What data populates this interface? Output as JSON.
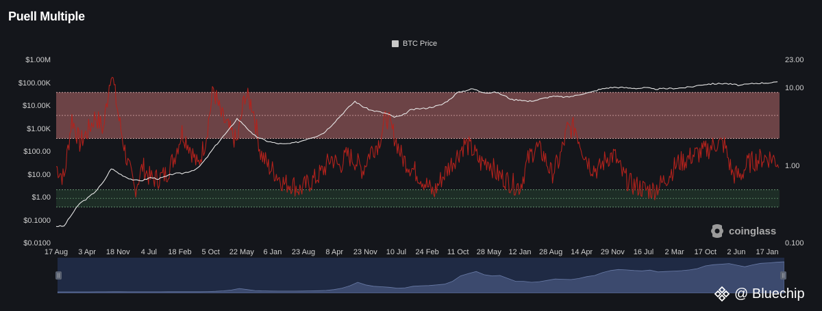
{
  "title": "Puell Multiple",
  "legend": {
    "label": "BTC Price",
    "color": "#c9c9c9"
  },
  "watermark": "coinglass",
  "brand": "@ Bluechip",
  "colors": {
    "background": "#14161b",
    "btc_price_line": "#e8e8e8",
    "puell_line": "#b3221c",
    "top_band": "#b56a6a",
    "bottom_band": "#2f5a3c",
    "navigator_area": "#3c4a6e"
  },
  "chart_data": {
    "type": "line",
    "title": "Puell Multiple",
    "legend_position": "top-center",
    "grid": false,
    "left_axis": {
      "scale": "log",
      "range": [
        0.01,
        1000000
      ],
      "ticks": [
        "$1.00M",
        "$100.00K",
        "$10.00K",
        "$1.00K",
        "$100.00",
        "$10.00",
        "$1.00",
        "$0.1000",
        "$0.0100"
      ]
    },
    "right_axis": {
      "scale": "log",
      "range": [
        0.1,
        23
      ],
      "ticks": [
        "23.00",
        "10.00",
        "1.00",
        "0.100"
      ]
    },
    "x_ticks": [
      "17 Aug",
      "3 Apr",
      "18 Nov",
      "4 Jul",
      "18 Feb",
      "5 Oct",
      "22 May",
      "6 Jan",
      "23 Aug",
      "8 Apr",
      "23 Nov",
      "10 Jul",
      "24 Feb",
      "11 Oct",
      "28 May",
      "12 Jan",
      "28 Aug",
      "14 Apr",
      "29 Nov",
      "16 Jul",
      "2 Mar",
      "17 Oct",
      "2 Jun",
      "17 Jan"
    ],
    "bands": [
      {
        "name": "top",
        "axis": "right",
        "from": 2.3,
        "to": 9
      },
      {
        "name": "bottom",
        "axis": "right",
        "from": 0.3,
        "to": 0.5
      }
    ],
    "series": [
      {
        "name": "BTC Price",
        "axis": "left",
        "x": [
          0,
          1,
          2,
          3,
          4,
          5,
          6,
          7,
          8,
          9,
          10,
          11,
          12,
          13,
          14,
          15,
          16,
          17,
          18,
          19,
          20,
          21,
          22,
          23,
          24,
          25,
          26,
          27,
          28,
          29,
          30,
          31,
          32,
          33,
          34,
          35,
          36,
          37,
          38,
          39,
          40,
          41,
          42,
          43,
          44,
          45,
          46,
          47,
          48,
          49,
          50,
          51,
          52,
          53,
          54,
          55,
          56,
          57,
          58,
          59,
          60,
          61,
          62,
          63,
          64,
          65,
          66,
          67,
          68,
          69,
          70,
          71,
          72,
          73,
          74,
          75,
          76,
          77,
          78,
          79,
          80,
          81,
          82,
          83,
          84,
          85,
          86,
          87,
          88,
          89,
          90,
          91,
          92
        ],
        "values": [
          0.06,
          0.06,
          0.2,
          0.6,
          1,
          2,
          5,
          20,
          12,
          8,
          6,
          6,
          8,
          7,
          9,
          12,
          12,
          15,
          20,
          50,
          150,
          400,
          1000,
          3000,
          1500,
          600,
          400,
          300,
          250,
          230,
          250,
          300,
          400,
          500,
          700,
          1500,
          3500,
          8000,
          17000,
          10000,
          7000,
          6000,
          5000,
          3500,
          4000,
          7000,
          8000,
          8500,
          10000,
          12000,
          20000,
          40000,
          50000,
          60000,
          45000,
          40000,
          42000,
          30000,
          20000,
          20000,
          17000,
          19000,
          23000,
          28000,
          27000,
          26000,
          30000,
          37000,
          42000,
          55000,
          65000,
          70000,
          68000,
          65000,
          63000,
          67000,
          58000,
          60000,
          62000,
          64000,
          68000,
          75000,
          90000,
          97000,
          100000,
          104000,
          94000,
          85000,
          96000,
          105000,
          108000,
          112000,
          115000
        ],
        "color": "#e8e8e8"
      },
      {
        "name": "Puell Multiple",
        "axis": "right",
        "x": [
          0,
          1,
          2,
          3,
          4,
          5,
          6,
          7,
          8,
          9,
          10,
          11,
          12,
          13,
          14,
          15,
          16,
          17,
          18,
          19,
          20,
          21,
          22,
          23,
          24,
          25,
          26,
          27,
          28,
          29,
          30,
          31,
          32,
          33,
          34,
          35,
          36,
          37,
          38,
          39,
          40,
          41,
          42,
          43,
          44,
          45,
          46,
          47,
          48,
          49,
          50,
          51,
          52,
          53,
          54,
          55,
          56,
          57,
          58,
          59,
          60,
          61,
          62,
          63,
          64,
          65,
          66,
          67,
          68,
          69,
          70,
          71,
          72,
          73,
          74,
          75,
          76,
          77,
          78,
          79,
          80,
          81,
          82,
          83,
          84,
          85,
          86,
          87,
          88,
          89,
          90,
          91,
          92
        ],
        "values": [
          1.0,
          0.7,
          4.2,
          2.0,
          2.8,
          4.5,
          3.0,
          18.0,
          4.0,
          1.2,
          0.5,
          1.0,
          0.7,
          0.7,
          0.8,
          1.3,
          2.8,
          1.8,
          1.0,
          2.2,
          10.0,
          4.5,
          3.0,
          2.0,
          8.5,
          6.0,
          1.5,
          1.0,
          0.8,
          0.6,
          0.6,
          0.5,
          0.6,
          0.7,
          0.9,
          1.3,
          1.0,
          1.4,
          1.2,
          0.9,
          1.6,
          2.0,
          4.5,
          2.5,
          1.3,
          1.0,
          0.8,
          0.6,
          0.45,
          0.7,
          1.0,
          1.4,
          2.0,
          1.6,
          1.1,
          1.2,
          0.8,
          0.7,
          0.6,
          0.55,
          1.2,
          1.8,
          1.4,
          0.8,
          1.2,
          3.0,
          3.2,
          1.6,
          1.0,
          0.9,
          1.3,
          1.4,
          0.8,
          0.6,
          0.55,
          0.5,
          0.5,
          0.6,
          0.8,
          1.1,
          1.2,
          1.4,
          1.5,
          1.7,
          2.0,
          1.9,
          0.8,
          0.75,
          1.1,
          1.2,
          1.3,
          1.3,
          1.1
        ],
        "color": "#b3221c"
      }
    ]
  }
}
